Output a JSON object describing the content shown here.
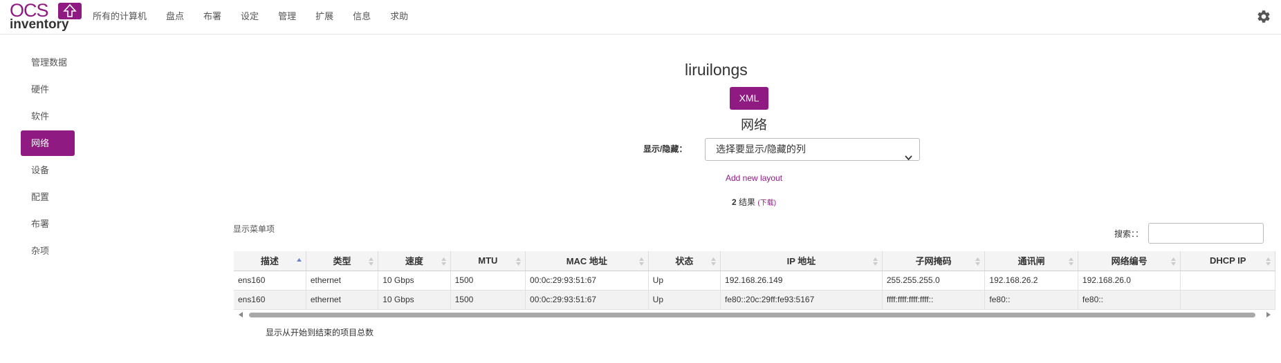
{
  "brand": {
    "logo_top": "OCS",
    "logo_bottom": "inventory"
  },
  "nav": {
    "items": [
      "所有的计算机",
      "盘点",
      "布署",
      "设定",
      "管理",
      "扩展",
      "信息",
      "求助"
    ]
  },
  "sidebar": {
    "items": [
      {
        "label": "管理数据",
        "active": false
      },
      {
        "label": "硬件",
        "active": false
      },
      {
        "label": "软件",
        "active": false
      },
      {
        "label": "网络",
        "active": true
      },
      {
        "label": "设备",
        "active": false
      },
      {
        "label": "配置",
        "active": false
      },
      {
        "label": "布署",
        "active": false
      },
      {
        "label": "杂项",
        "active": false
      }
    ]
  },
  "main": {
    "computer_name": "liruilongs",
    "xml_button": "XML",
    "section_title": "网络",
    "show_hide_label": "显示/隐藏：",
    "column_select_value": "选择要显示/隐藏的列",
    "add_layout": "Add new layout",
    "results_count": "2",
    "results_label": "结果",
    "download_label": "(下载)",
    "show_menu": "显示菜单项",
    "search_label": "搜索：：",
    "search_value": "",
    "footer": "显示从开始到结束的项目总数"
  },
  "table": {
    "columns": [
      "描述",
      "类型",
      "速度",
      "MTU",
      "MAC 地址",
      "状态",
      "IP 地址",
      "子网掩码",
      "通讯闸",
      "网络编号",
      "DHCP IP"
    ],
    "rows": [
      [
        "ens160",
        "ethernet",
        "10 Gbps",
        "1500",
        "00:0c:29:93:51:67",
        "Up",
        "192.168.26.149",
        "255.255.255.0",
        "192.168.26.2",
        "192.168.26.0",
        ""
      ],
      [
        "ens160",
        "ethernet",
        "10 Gbps",
        "1500",
        "00:0c:29:93:51:67",
        "Up",
        "fe80::20c:29ff:fe93:5167",
        "ffff:ffff:ffff:ffff::",
        "fe80::",
        "fe80::",
        ""
      ]
    ]
  },
  "colors": {
    "accent": "#8e1a82"
  }
}
